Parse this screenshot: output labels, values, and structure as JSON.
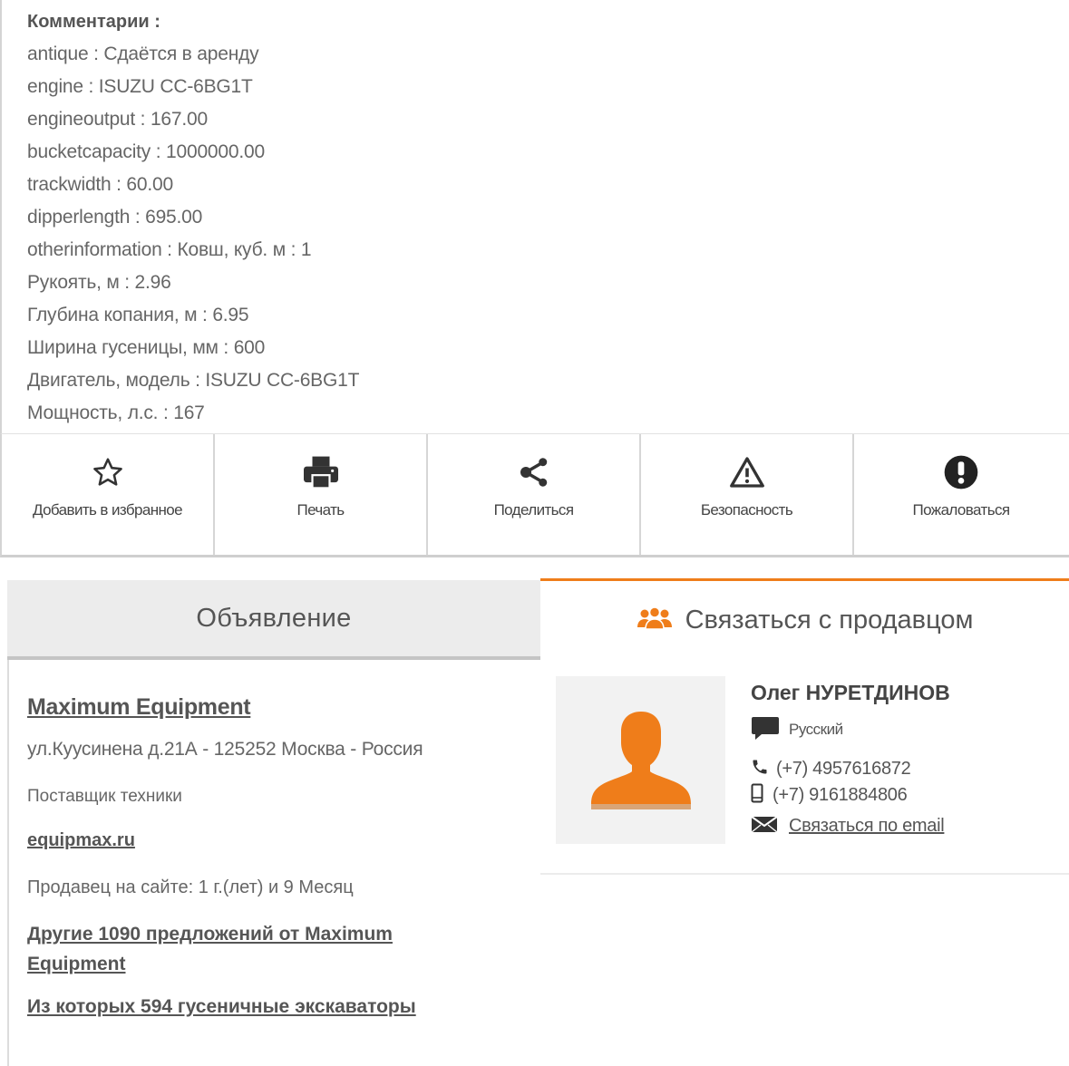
{
  "comments": {
    "title": "Комментарии :",
    "lines": [
      "antique : Сдаётся в аренду",
      "engine : ISUZU CC-6BG1T",
      "engineoutput : 167.00",
      "bucketcapacity : 1000000.00",
      "trackwidth : 60.00",
      "dipperlength : 695.00",
      "otherinformation : Ковш, куб. м : 1",
      "Рукоять, м : 2.96",
      "Глубина копания, м : 6.95",
      "Ширина гусеницы, мм : 600",
      "Двигатель, модель : ISUZU CC-6BG1T",
      "Мощность, л.с. : 167"
    ]
  },
  "actions": {
    "favorite": {
      "label": "Добавить в избранное",
      "icon": "star-outline-icon"
    },
    "print": {
      "label": "Печать",
      "icon": "printer-icon"
    },
    "share": {
      "label": "Поделиться",
      "icon": "share-icon"
    },
    "safety": {
      "label": "Безопасность",
      "icon": "warning-triangle-icon"
    },
    "report": {
      "label": "Пожаловаться",
      "icon": "exclamation-circle-icon"
    }
  },
  "tabs": {
    "listing": "Объявление",
    "contact": "Связаться с продавцом",
    "active_color": "#ef7d1a"
  },
  "seller": {
    "name": "Maximum Equipment",
    "address": "ул.Куусинена д.21А - 125252 Москва - Россия",
    "type": "Поставщик техники",
    "website": "equipmax.ru",
    "since": "Продавец на сайте: 1 г.(лет) и 9 Месяц",
    "other_offers": "Другие 1090 предложений от Maximum Equipment",
    "subset_offers": "Из которых 594 гусеничные экскаваторы"
  },
  "contact": {
    "name": "Олег НУРЕТДИНОВ",
    "language": "Русский",
    "phone": "(+7) 4957616872",
    "mobile": "(+7) 9161884806",
    "email_link": "Связаться по email",
    "avatar_color": "#ef7d1a"
  }
}
